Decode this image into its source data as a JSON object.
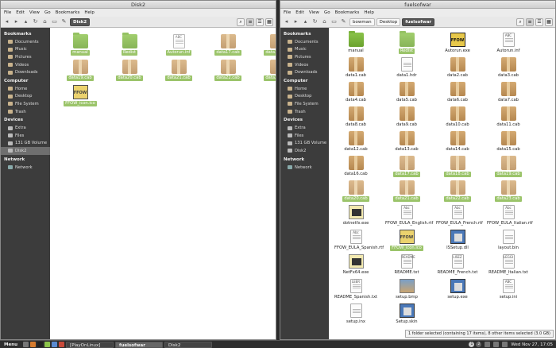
{
  "left_window": {
    "title": "Disk2",
    "menu": [
      "File",
      "Edit",
      "View",
      "Go",
      "Bookmarks",
      "Help"
    ],
    "breadcrumbs": [
      {
        "label": "Disk2",
        "active": true
      }
    ],
    "files": [
      {
        "name": "manual",
        "type": "folder",
        "selected": true
      },
      {
        "name": "Redist",
        "type": "folder",
        "selected": true
      },
      {
        "name": "Autorun.inf",
        "type": "doc",
        "tag": "ABC",
        "selected": true
      },
      {
        "name": "data17.cab",
        "type": "cab",
        "selected": true
      },
      {
        "name": "data18.cab",
        "type": "cab",
        "selected": true
      },
      {
        "name": "data19.cab",
        "type": "cab",
        "selected": true
      },
      {
        "name": "data20.cab",
        "type": "cab",
        "selected": true
      },
      {
        "name": "data21.cab",
        "type": "cab",
        "selected": true
      },
      {
        "name": "data22.cab",
        "type": "cab",
        "selected": true
      },
      {
        "name": "data23.cab",
        "type": "cab",
        "selected": true
      },
      {
        "name": "FFOW_icon.ico",
        "type": "ffow",
        "selected": true
      }
    ]
  },
  "right_window": {
    "title": "fuelsofwar",
    "menu": [
      "File",
      "Edit",
      "View",
      "Go",
      "Bookmarks",
      "Help"
    ],
    "breadcrumbs": [
      {
        "label": "bowman",
        "active": false
      },
      {
        "label": "Desktop",
        "active": false
      },
      {
        "label": "fuelsofwar",
        "active": true
      }
    ],
    "files": [
      {
        "name": "manual",
        "type": "folder",
        "selected": false
      },
      {
        "name": "Redist",
        "type": "folder",
        "selected": true
      },
      {
        "name": "Autorun.exe",
        "type": "ffow",
        "selected": false
      },
      {
        "name": "Autorun.inf",
        "type": "doc",
        "tag": "ABC",
        "selected": false
      },
      {
        "name": "data1.cab",
        "type": "cab",
        "selected": false
      },
      {
        "name": "data1.hdr",
        "type": "doc",
        "tag": "",
        "selected": false
      },
      {
        "name": "data2.cab",
        "type": "cab",
        "selected": false
      },
      {
        "name": "data3.cab",
        "type": "cab",
        "selected": false
      },
      {
        "name": "data4.cab",
        "type": "cab",
        "selected": false
      },
      {
        "name": "data5.cab",
        "type": "cab",
        "selected": false
      },
      {
        "name": "data6.cab",
        "type": "cab",
        "selected": false
      },
      {
        "name": "data7.cab",
        "type": "cab",
        "selected": false
      },
      {
        "name": "data8.cab",
        "type": "cab",
        "selected": false
      },
      {
        "name": "data9.cab",
        "type": "cab",
        "selected": false
      },
      {
        "name": "data10.cab",
        "type": "cab",
        "selected": false
      },
      {
        "name": "data11.cab",
        "type": "cab",
        "selected": false
      },
      {
        "name": "data12.cab",
        "type": "cab",
        "selected": false
      },
      {
        "name": "data13.cab",
        "type": "cab",
        "selected": false
      },
      {
        "name": "data14.cab",
        "type": "cab",
        "selected": false
      },
      {
        "name": "data15.cab",
        "type": "cab",
        "selected": false
      },
      {
        "name": "data16.cab",
        "type": "cab",
        "selected": false
      },
      {
        "name": "data17.cab",
        "type": "cab",
        "selected": true
      },
      {
        "name": "data18.cab",
        "type": "cab",
        "selected": true
      },
      {
        "name": "data19.cab",
        "type": "cab",
        "selected": true
      },
      {
        "name": "data20.cab",
        "type": "cab",
        "selected": true
      },
      {
        "name": "data21.cab",
        "type": "cab",
        "selected": true
      },
      {
        "name": "data22.cab",
        "type": "cab",
        "selected": true
      },
      {
        "name": "data23.cab",
        "type": "cab",
        "selected": true
      },
      {
        "name": "dotnetfx.exe",
        "type": "exe",
        "selected": false
      },
      {
        "name": "FFOW_EULA_English.rtf",
        "type": "doc",
        "tag": "Abc",
        "selected": false
      },
      {
        "name": "FFOW_EULA_French.rtf",
        "type": "doc",
        "tag": "Abc",
        "selected": false
      },
      {
        "name": "FFOW_EULA_Italian.rtf",
        "type": "doc",
        "tag": "Abc",
        "selected": false
      },
      {
        "name": "FFOW_EULA_Spanish.rtf",
        "type": "doc",
        "tag": "Abc",
        "selected": false
      },
      {
        "name": "FFOW_icon.ico",
        "type": "ffow",
        "selected": true
      },
      {
        "name": "ISSetup.dll",
        "type": "setup",
        "selected": false
      },
      {
        "name": "layout.bin",
        "type": "doc",
        "tag": "",
        "selected": false
      },
      {
        "name": "NetFx64.exe",
        "type": "exe",
        "selected": false
      },
      {
        "name": "README.txt",
        "type": "doc",
        "tag": "README",
        "selected": false
      },
      {
        "name": "README_French.txt",
        "type": "doc",
        "tag": "LISEZ",
        "selected": false
      },
      {
        "name": "README_Italian.txt",
        "type": "doc",
        "tag": "LEGGI",
        "selected": false
      },
      {
        "name": "README_Spanish.txt",
        "type": "doc",
        "tag": "LEER",
        "selected": false
      },
      {
        "name": "setup.bmp",
        "type": "bmp",
        "selected": false
      },
      {
        "name": "setup.exe",
        "type": "setup",
        "selected": false
      },
      {
        "name": "setup.ini",
        "type": "doc",
        "tag": "ABC",
        "selected": false
      },
      {
        "name": "setup.inx",
        "type": "doc",
        "tag": "",
        "selected": false
      },
      {
        "name": "Setup.skin",
        "type": "setup",
        "selected": false
      }
    ],
    "status": "1 folder selected (containing 17 items), 8 other items selected (3.0 GB)"
  },
  "sidebar": {
    "bookmarks_title": "Bookmarks",
    "bookmarks": [
      "Documents",
      "Music",
      "Pictures",
      "Videos",
      "Downloads"
    ],
    "computer_title": "Computer",
    "computer": [
      "Home",
      "Desktop",
      "File System",
      "Trash"
    ],
    "devices_title": "Devices",
    "devices": [
      "Extra",
      "Files",
      "131 GB Volume",
      "Disk2"
    ],
    "network_title": "Network",
    "network": [
      "Network"
    ]
  },
  "taskbar": {
    "menu_label": "Menu",
    "tasks": [
      {
        "label": "[PlayOnLinux]",
        "active": false
      },
      {
        "label": "fuelsofwar",
        "active": true
      },
      {
        "label": "Disk2",
        "active": false
      }
    ],
    "workspaces": [
      "1",
      "2"
    ],
    "clock": "Wed Nov 27, 17:05"
  }
}
